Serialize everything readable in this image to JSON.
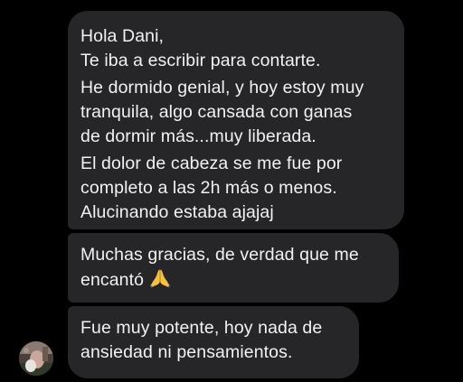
{
  "conversation": {
    "messages": [
      {
        "lines": [
          "Hola Dani,",
          "Te iba a escribir para contarte.",
          "He dormido genial, y hoy estoy muy",
          "tranquila, algo cansada con ganas",
          "de dormir más...muy liberada.",
          "El dolor de cabeza se me fue por",
          "completo a las 2h más o menos.",
          "Alucinando estaba ajajaj"
        ]
      },
      {
        "lines": [
          "Muchas gracias, de verdad que me",
          "encantó"
        ],
        "emoji_icon": "folded-hands-icon"
      },
      {
        "lines": [
          "Fue muy potente, hoy nada de",
          "ansiedad ni pensamientos."
        ]
      }
    ],
    "sender_avatar": "avatar-photo"
  },
  "colors": {
    "background": "#000000",
    "bubble": "#262628",
    "text": "#f2f2f2",
    "emoji": "#f4c23c"
  }
}
